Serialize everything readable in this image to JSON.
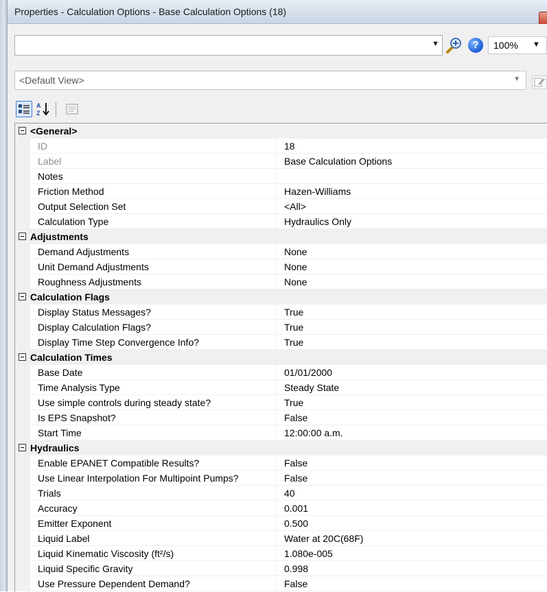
{
  "window": {
    "title": "Properties - Calculation Options - Base Calculation Options (18)"
  },
  "toolbar": {
    "selector_value": "",
    "selector_arrow": "▼",
    "zoom_icon": "zoom-in-icon",
    "help_icon_glyph": "?",
    "zoom_value": "100%",
    "zoom_arrow": "▼",
    "view_value": "<Default View>",
    "view_arrow": "▼",
    "categorized_icon": "categorized-view-icon",
    "alpha_icon": "sort-alphabetical-icon",
    "pages_icon": "property-pages-icon"
  },
  "colors": {
    "title_gradient_top": "#e9eef5",
    "close_button": "#c9412b",
    "selection_accent": "#3a7bd5",
    "readonly_text": "#8c8c8c"
  },
  "grid": {
    "categories": [
      {
        "label": "<General>",
        "properties": [
          {
            "name": "ID",
            "value": "18",
            "readonly": true
          },
          {
            "name": "Label",
            "value": "Base Calculation Options",
            "readonly": true
          },
          {
            "name": "Notes",
            "value": ""
          },
          {
            "name": "Friction Method",
            "value": "Hazen-Williams"
          },
          {
            "name": "Output Selection Set",
            "value": "<All>"
          },
          {
            "name": "Calculation Type",
            "value": "Hydraulics Only"
          }
        ]
      },
      {
        "label": "Adjustments",
        "properties": [
          {
            "name": "Demand Adjustments",
            "value": "None"
          },
          {
            "name": "Unit Demand Adjustments",
            "value": "None"
          },
          {
            "name": "Roughness Adjustments",
            "value": "None"
          }
        ]
      },
      {
        "label": "Calculation Flags",
        "properties": [
          {
            "name": "Display Status Messages?",
            "value": "True"
          },
          {
            "name": "Display Calculation Flags?",
            "value": "True"
          },
          {
            "name": "Display Time Step Convergence Info?",
            "value": "True"
          }
        ]
      },
      {
        "label": "Calculation Times",
        "properties": [
          {
            "name": "Base Date",
            "value": "01/01/2000"
          },
          {
            "name": "Time Analysis Type",
            "value": "Steady State"
          },
          {
            "name": "Use simple controls during steady state?",
            "value": "True"
          },
          {
            "name": "Is EPS Snapshot?",
            "value": "False"
          },
          {
            "name": "Start Time",
            "value": "12:00:00 a.m."
          }
        ]
      },
      {
        "label": "Hydraulics",
        "properties": [
          {
            "name": "Enable EPANET Compatible Results?",
            "value": "False"
          },
          {
            "name": "Use Linear Interpolation For Multipoint Pumps?",
            "value": "False"
          },
          {
            "name": "Trials",
            "value": "40"
          },
          {
            "name": "Accuracy",
            "value": "0.001"
          },
          {
            "name": "Emitter Exponent",
            "value": "0.500"
          },
          {
            "name": "Liquid Label",
            "value": "Water at 20C(68F)"
          },
          {
            "name": "Liquid Kinematic Viscosity (ft²/s)",
            "value": "1.080e-005"
          },
          {
            "name": "Liquid Specific Gravity",
            "value": "0.998"
          },
          {
            "name": "Use Pressure Dependent Demand?",
            "value": "False"
          }
        ]
      }
    ]
  }
}
